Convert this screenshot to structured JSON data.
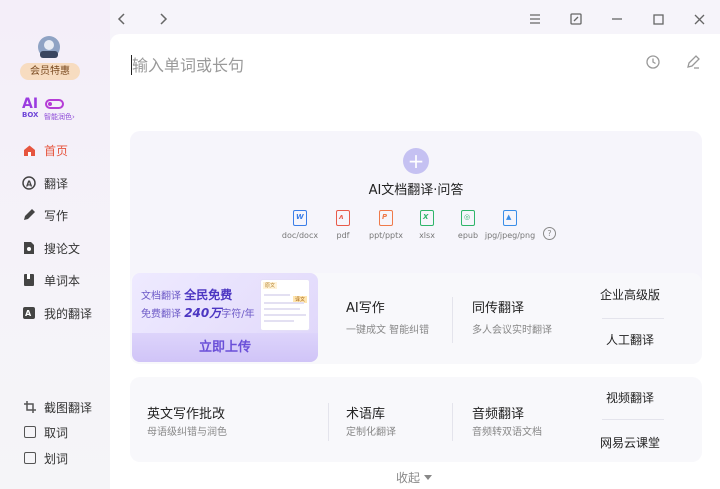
{
  "sidebar": {
    "member_label": "会员特惠",
    "aibox": {
      "logo_ai": "AI",
      "logo_box": "BOX",
      "subtitle": "智能润色›"
    },
    "nav": [
      {
        "label": "首页",
        "icon": "home-icon",
        "active": true
      },
      {
        "label": "翻译",
        "icon": "translate-icon",
        "active": false
      },
      {
        "label": "写作",
        "icon": "pen-icon",
        "active": false
      },
      {
        "label": "搜论文",
        "icon": "paper-search-icon",
        "active": false
      },
      {
        "label": "单词本",
        "icon": "wordbook-icon",
        "active": false
      },
      {
        "label": "我的翻译",
        "icon": "my-translation-icon",
        "active": false
      }
    ],
    "bottom": [
      {
        "label": "截图翻译",
        "icon": "crop-icon"
      },
      {
        "label": "取词",
        "icon": "checkbox-icon"
      },
      {
        "label": "划词",
        "icon": "checkbox-icon"
      }
    ]
  },
  "search": {
    "placeholder": "输入单词或长句"
  },
  "doc_panel": {
    "title": "AI文档翻译·问答",
    "file_types": [
      {
        "label": "doc/docx",
        "glyph": "W",
        "color": "#3b7ee8"
      },
      {
        "label": "pdf",
        "glyph": "⌂",
        "color": "#e85a4a"
      },
      {
        "label": "ppt/pptx",
        "glyph": "P",
        "color": "#ef7a4a"
      },
      {
        "label": "xlsx",
        "glyph": "X",
        "color": "#2fb56a"
      },
      {
        "label": "epub",
        "glyph": "◎",
        "color": "#2fb56a"
      },
      {
        "label": "jpg/jpeg/png",
        "glyph": "▲",
        "color": "#3a8ee8"
      }
    ]
  },
  "promo": {
    "line1_prefix": "文档翻译",
    "line1_bold": "全民免费",
    "line2_prefix": "免费翻译",
    "line2_bold": "240万",
    "line2_suffix": "字符/年",
    "upload_label": "立即上传",
    "doc_tag": "原文",
    "doc_tag2": "译文"
  },
  "features_row1": [
    {
      "title": "AI写作",
      "sub": "一键成文 智能纠错"
    },
    {
      "title": "同传翻译",
      "sub": "多人会议实时翻译"
    }
  ],
  "side_links_row1": [
    "企业高级版",
    "人工翻译"
  ],
  "features_row2": [
    {
      "title": "英文写作批改",
      "sub": "母语级纠错与润色"
    },
    {
      "title": "术语库",
      "sub": "定制化翻译"
    },
    {
      "title": "音频翻译",
      "sub": "音频转双语文档"
    }
  ],
  "side_links_row2": [
    "视频翻译",
    "网易云课堂"
  ],
  "collapse_label": "收起"
}
